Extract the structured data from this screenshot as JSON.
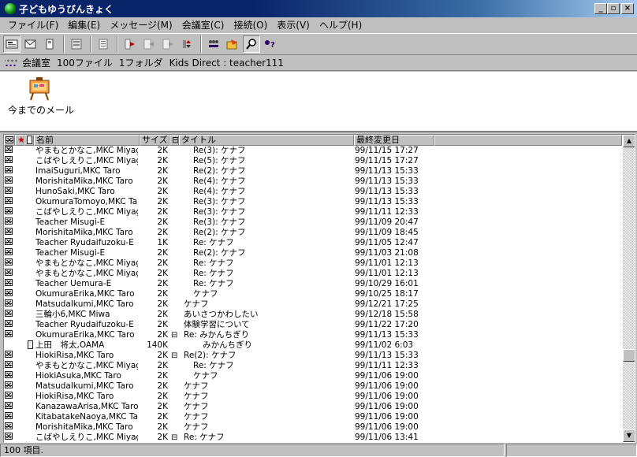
{
  "window": {
    "title": "子どもゆうびんきょく"
  },
  "menu": [
    "ファイル(F)",
    "編集(E)",
    "メッセージ(M)",
    "会議室(C)",
    "接続(O)",
    "表示(V)",
    "ヘルプ(H)"
  ],
  "toolbar": [
    "new-message-icon",
    "reply-icon",
    "attach-icon",
    "address-book-icon",
    "view-icon",
    "send-icon",
    "receive-icon",
    "forward-icon",
    "sort-icon",
    "meeting-room-icon",
    "folder-open-icon",
    "find-icon",
    "help-icon"
  ],
  "path": {
    "room": "会議室",
    "files": "100ファイル",
    "folders": "1フォルダ",
    "account": "Kids Direct : teacher111"
  },
  "folder": {
    "label": "今までのメール"
  },
  "columns": {
    "name": "名前",
    "size": "サイズ",
    "title": "タイトル",
    "modified": "最終変更日"
  },
  "rows": [
    {
      "from": "やまもとかなこ,MKC Miyagas",
      "size": "2K",
      "title": "Re(3): ケナフ",
      "date": "99/11/15  17:27",
      "indent": 1,
      "type": "mail"
    },
    {
      "from": "こばやしえりこ,MKC Miyagas",
      "size": "2K",
      "title": "Re(5): ケナフ",
      "date": "99/11/15  17:27",
      "indent": 1,
      "type": "mail"
    },
    {
      "from": "ImaiSuguri,MKC Taro",
      "size": "2K",
      "title": "Re(2): ケナフ",
      "date": "99/11/13  15:33",
      "indent": 1,
      "type": "mail"
    },
    {
      "from": "MorishitaMika,MKC Taro",
      "size": "2K",
      "title": "Re(4): ケナフ",
      "date": "99/11/13  15:33",
      "indent": 1,
      "type": "mail"
    },
    {
      "from": "HunoSaki,MKC Taro",
      "size": "2K",
      "title": "Re(4): ケナフ",
      "date": "99/11/13  15:33",
      "indent": 1,
      "type": "mail"
    },
    {
      "from": "OkumuraTomoyo,MKC Taro",
      "size": "2K",
      "title": "Re(3): ケナフ",
      "date": "99/11/13  15:33",
      "indent": 1,
      "type": "mail"
    },
    {
      "from": "こばやしえりこ,MKC Miyagas",
      "size": "2K",
      "title": "Re(3): ケナフ",
      "date": "99/11/11  12:33",
      "indent": 1,
      "type": "mail"
    },
    {
      "from": "Teacher Misugi-E",
      "size": "2K",
      "title": "Re(3): ケナフ",
      "date": "99/11/09  20:47",
      "indent": 1,
      "type": "mail"
    },
    {
      "from": "MorishitaMika,MKC Taro",
      "size": "2K",
      "title": "Re(2): ケナフ",
      "date": "99/11/09  18:45",
      "indent": 1,
      "type": "mail"
    },
    {
      "from": "Teacher Ryudaifuzoku-E",
      "size": "1K",
      "title": "Re: ケナフ",
      "date": "99/11/05  12:47",
      "indent": 1,
      "type": "mail"
    },
    {
      "from": "Teacher Misugi-E",
      "size": "2K",
      "title": "Re(2): ケナフ",
      "date": "99/11/03  21:08",
      "indent": 1,
      "type": "mail"
    },
    {
      "from": "やまもとかなこ,MKC Miyagas",
      "size": "2K",
      "title": "Re: ケナフ",
      "date": "99/11/01  12:13",
      "indent": 1,
      "type": "mail"
    },
    {
      "from": "やまもとかなこ,MKC Miyagas",
      "size": "2K",
      "title": "Re: ケナフ",
      "date": "99/11/01  12:13",
      "indent": 1,
      "type": "mail"
    },
    {
      "from": "Teacher Uemura-E",
      "size": "2K",
      "title": "Re: ケナフ",
      "date": "99/10/29  16:01",
      "indent": 1,
      "type": "mail"
    },
    {
      "from": "OkumuraErika,MKC Taro",
      "size": "2K",
      "title": "ケナフ",
      "date": "99/10/25  18:17",
      "indent": 1,
      "type": "mail"
    },
    {
      "from": "MatsudaIkumi,MKC Taro",
      "size": "2K",
      "title": "ケナフ",
      "date": "99/12/21  17:25",
      "indent": 0,
      "type": "mail"
    },
    {
      "from": "三輪小6,MKC Miwa",
      "size": "2K",
      "title": "あいさつかわしたい",
      "date": "99/12/18  15:58",
      "indent": 0,
      "type": "mail"
    },
    {
      "from": "Teacher Ryudaifuzoku-E",
      "size": "2K",
      "title": "体験学習について",
      "date": "99/11/22  17:20",
      "indent": 0,
      "type": "mail"
    },
    {
      "from": "OkumuraErika,MKC Taro",
      "size": "2K",
      "title": "Re: みかんちぎり",
      "date": "99/11/13  15:33",
      "indent": 0,
      "type": "mail",
      "exp": "⊟"
    },
    {
      "from": "上田　将太,OAMA",
      "size": "140K",
      "title": "みかんちぎり",
      "date": "99/11/02  6:03",
      "indent": 2,
      "type": "attach"
    },
    {
      "from": "HiokiRisa,MKC Taro",
      "size": "2K",
      "title": "Re(2): ケナフ",
      "date": "99/11/13  15:33",
      "indent": 0,
      "type": "mail",
      "exp": "⊟"
    },
    {
      "from": "やまもとかなこ,MKC Miyagas",
      "size": "2K",
      "title": "Re: ケナフ",
      "date": "99/11/11  12:33",
      "indent": 1,
      "type": "mail"
    },
    {
      "from": "HiokiAsuka,MKC Taro",
      "size": "2K",
      "title": "ケナフ",
      "date": "99/11/06  19:00",
      "indent": 1,
      "type": "mail"
    },
    {
      "from": "MatsudaIkumi,MKC Taro",
      "size": "2K",
      "title": "ケナフ",
      "date": "99/11/06  19:00",
      "indent": 0,
      "type": "mail"
    },
    {
      "from": "HiokiRisa,MKC Taro",
      "size": "2K",
      "title": "ケナフ",
      "date": "99/11/06  19:00",
      "indent": 0,
      "type": "mail"
    },
    {
      "from": "KanazawaArisa,MKC Taro",
      "size": "2K",
      "title": "ケナフ",
      "date": "99/11/06  19:00",
      "indent": 0,
      "type": "mail"
    },
    {
      "from": "KitabatakeNaoya,MKC Taro",
      "size": "2K",
      "title": "ケナフ",
      "date": "99/11/06  19:00",
      "indent": 0,
      "type": "mail"
    },
    {
      "from": "MorishitaMika,MKC Taro",
      "size": "2K",
      "title": "ケナフ",
      "date": "99/11/06  19:00",
      "indent": 0,
      "type": "mail"
    },
    {
      "from": "こばやしえりこ,MKC Miyagas",
      "size": "2K",
      "title": "Re: ケナフ",
      "date": "99/11/06  13:41",
      "indent": 0,
      "type": "mail",
      "exp": "⊟"
    }
  ],
  "status": {
    "text": "100 項目."
  }
}
